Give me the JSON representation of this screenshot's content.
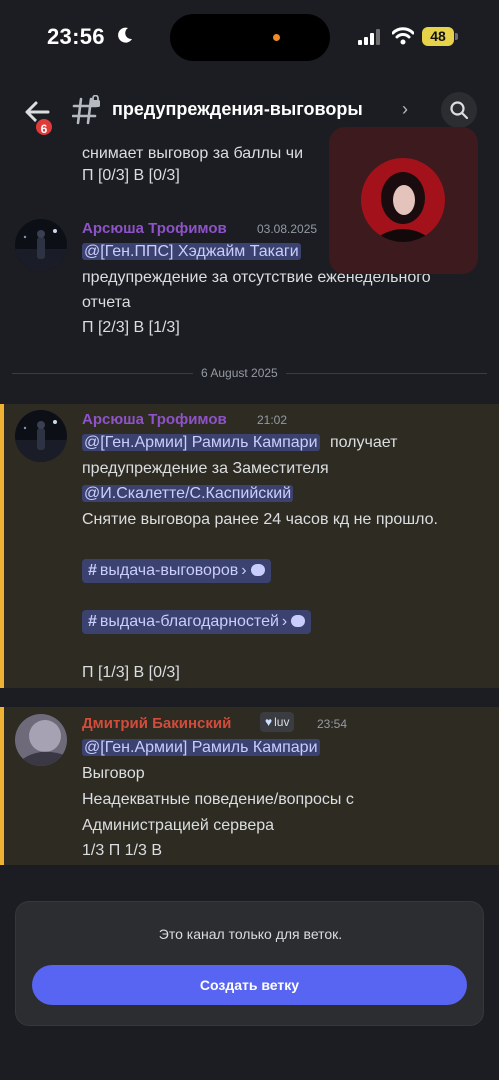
{
  "status_bar": {
    "time": "23:56",
    "battery": "48"
  },
  "header": {
    "back_badge": "6",
    "channel_name": "предупреждения-выговоры",
    "chevron": "›"
  },
  "messages": [
    {
      "id": "prev-tail",
      "lines": [
        "снимает выговор за баллы чи",
        "П [0/3] В [0/3]"
      ]
    },
    {
      "id": "arsyusha-1",
      "author": "Арсюша Трофимов",
      "timestamp": "03.08.2025",
      "mention": "@[Ген.ППС] Хэджайм Такаги",
      "lines": [
        "предупреждение  за отсутствие еженедельного",
        "отчета",
        "П [2/3] В [1/3]"
      ]
    },
    {
      "id": "arsyusha-2",
      "author": "Арсюша Трофимов",
      "timestamp": "21:02",
      "mention": "@[Ген.Армии] Рамиль Кампари",
      "mention_suffix": "получает",
      "line2": "предупреждение за Заместителя",
      "mention2": "@И.Скалетте/С.Каспийский",
      "line3": "Снятие выговора ранее 24 часов кд не прошло.",
      "channel_link_1": "выдача-выговоров",
      "channel_link_2": "выдача-благодарностей",
      "footer_line": "П [1/3] В [0/3]"
    },
    {
      "id": "dmitry",
      "author": "Дмитрий Бакинский",
      "badge": "luv",
      "timestamp": "23:54",
      "mention": "@[Ген.Армии] Рамиль Кампари",
      "lines": [
        "Выговор",
        "Неадекватные поведение/вопросы с",
        "Администрацией сервера",
        "1/3 П 1/3 В"
      ]
    }
  ],
  "date_divider": "6 August 2025",
  "footer": {
    "notice": "Это канал только для веток.",
    "button_label": "Создать ветку"
  },
  "colors": {
    "author_arsyusha": "#8e52c9",
    "author_dmitry": "#d24c3c",
    "accent": "#5865f2",
    "highlight_bar": "#f0b232"
  }
}
